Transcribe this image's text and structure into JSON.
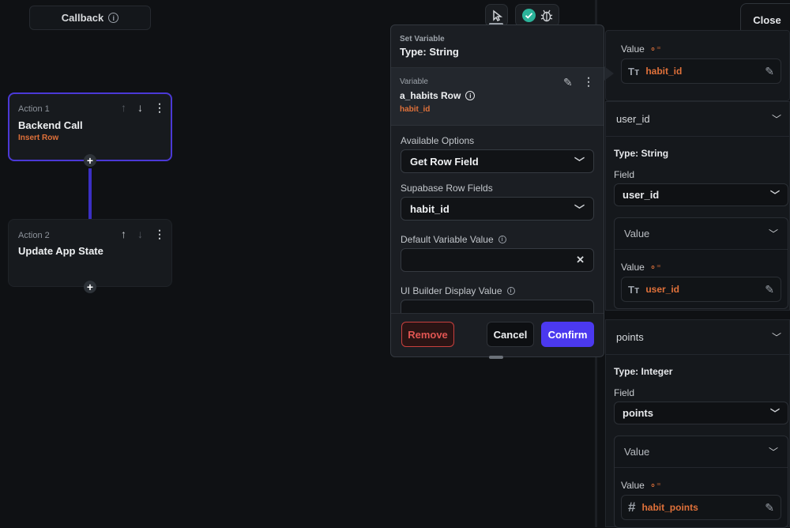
{
  "callback": {
    "label": "Callback"
  },
  "actions": [
    {
      "index_label": "Action 1",
      "title": "Backend Call",
      "subtitle": "Insert Row"
    },
    {
      "index_label": "Action 2",
      "title": "Update App State",
      "subtitle": ""
    }
  ],
  "toolbar": {
    "close_label": "Close"
  },
  "modal": {
    "header_small": "Set Variable",
    "header_type": "Type: String",
    "variable_label": "Variable",
    "variable_name": "a_habits Row",
    "variable_field": "habit_id",
    "available_options_label": "Available Options",
    "available_options_value": "Get Row Field",
    "row_fields_label": "Supabase Row Fields",
    "row_fields_value": "habit_id",
    "default_value_label": "Default Variable Value",
    "default_value_value": "",
    "ui_builder_label": "UI Builder Display Value",
    "remove_label": "Remove",
    "cancel_label": "Cancel",
    "confirm_label": "Confirm"
  },
  "right_panel": {
    "top_value_label": "Value",
    "top_value": "habit_id",
    "sections": [
      {
        "header": "user_id",
        "type": "Type: String",
        "field_label": "Field",
        "field_value": "user_id",
        "value_header": "Value",
        "value_label": "Value",
        "value": "user_id"
      },
      {
        "header": "points",
        "type": "Type: Integer",
        "field_label": "Field",
        "field_value": "points",
        "value_header": "Value",
        "value_label": "Value",
        "value": "habit_points"
      }
    ]
  },
  "colors": {
    "accent": "#4b39ef",
    "orange": "#e0713a",
    "danger": "#e05552",
    "success": "#2bb39a"
  },
  "icons": [
    "info-icon",
    "arrow-up-icon",
    "arrow-down-icon",
    "more-vertical-icon",
    "plus-icon",
    "cursor-icon",
    "check-circle-icon",
    "bug-icon",
    "pencil-icon",
    "chevron-down-icon",
    "text-type-icon",
    "hash-icon",
    "variable-icon",
    "close-icon"
  ]
}
